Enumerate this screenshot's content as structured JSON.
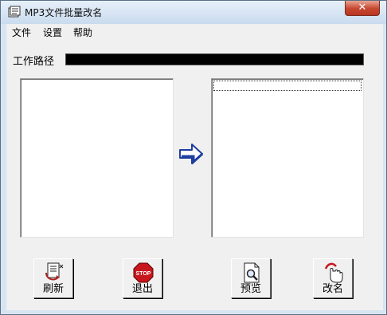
{
  "window": {
    "title": "MP3文件批量改名",
    "close_glyph": "✕"
  },
  "menu": {
    "items": [
      "文件",
      "设置",
      "帮助"
    ]
  },
  "path": {
    "label": "工作路径",
    "value": ""
  },
  "buttons": {
    "refresh": {
      "label": "刷新",
      "icon": "refresh-icon"
    },
    "quit": {
      "label": "退出",
      "icon": "stop-sign-icon",
      "sign_text": "STOP"
    },
    "preview": {
      "label": "预览",
      "icon": "magnifier-document-icon"
    },
    "rename": {
      "label": "改名",
      "icon": "pointing-hand-icon"
    }
  },
  "colors": {
    "stop_red": "#c8161d",
    "arrow_blue": "#1f3fa0",
    "path_field": "#000000"
  }
}
